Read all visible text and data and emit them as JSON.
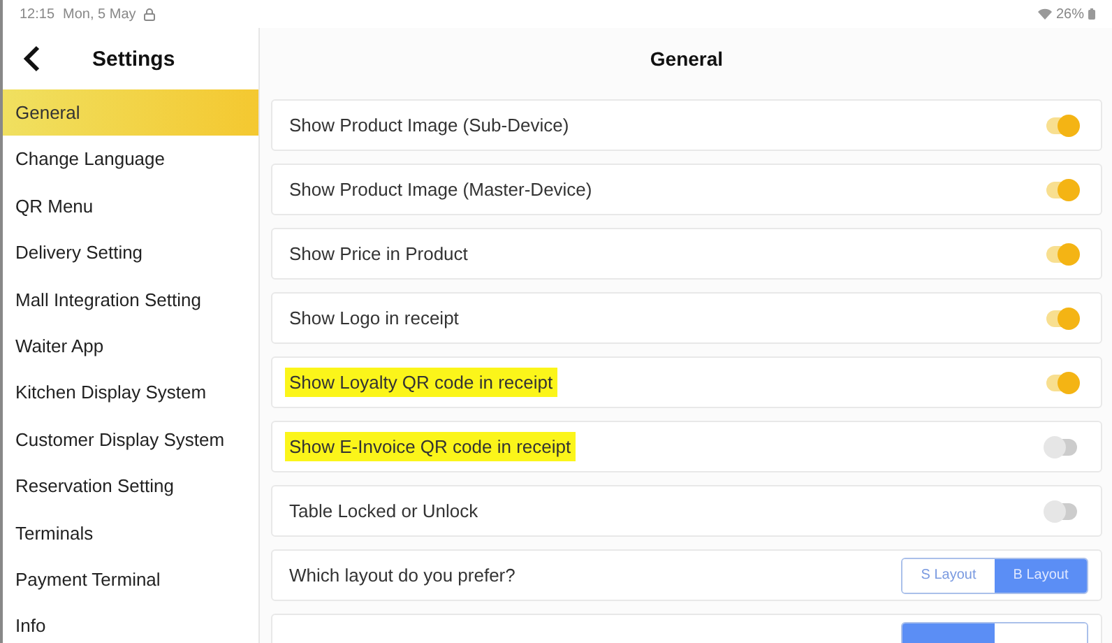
{
  "status_bar": {
    "time": "12:15",
    "date": "Mon, 5 May",
    "battery": "26%"
  },
  "sidebar": {
    "title": "Settings",
    "items": [
      {
        "label": "General",
        "selected": true
      },
      {
        "label": "Change Language",
        "selected": false
      },
      {
        "label": "QR Menu",
        "selected": false
      },
      {
        "label": "Delivery Setting",
        "selected": false
      },
      {
        "label": "Mall Integration Setting",
        "selected": false
      },
      {
        "label": "Waiter App",
        "selected": false
      },
      {
        "label": "Kitchen Display System",
        "selected": false
      },
      {
        "label": "Customer Display System",
        "selected": false
      },
      {
        "label": "Reservation Setting",
        "selected": false
      },
      {
        "label": "Terminals",
        "selected": false
      },
      {
        "label": "Payment Terminal",
        "selected": false
      },
      {
        "label": "Info",
        "selected": false
      }
    ]
  },
  "main": {
    "title": "General",
    "rows": [
      {
        "kind": "toggle",
        "label": "Show Product Image (Sub-Device)",
        "on": true,
        "highlighted": false
      },
      {
        "kind": "toggle",
        "label": "Show Product Image (Master-Device)",
        "on": true,
        "highlighted": false
      },
      {
        "kind": "toggle",
        "label": "Show Price in Product",
        "on": true,
        "highlighted": false
      },
      {
        "kind": "toggle",
        "label": "Show Logo in receipt",
        "on": true,
        "highlighted": false
      },
      {
        "kind": "toggle",
        "label": "Show Loyalty QR code in receipt",
        "on": true,
        "highlighted": true
      },
      {
        "kind": "toggle",
        "label": "Show E-Invoice QR code in receipt",
        "on": false,
        "highlighted": true
      },
      {
        "kind": "toggle",
        "label": "Table Locked or Unlock",
        "on": false,
        "highlighted": false
      },
      {
        "kind": "segmented",
        "label": "Which layout do you prefer?",
        "options": [
          {
            "label": "S Layout",
            "selected": false
          },
          {
            "label": "B Layout",
            "selected": true
          }
        ]
      },
      {
        "kind": "segmented",
        "options": [
          {
            "selected": true
          },
          {
            "selected": false
          }
        ]
      }
    ]
  }
}
